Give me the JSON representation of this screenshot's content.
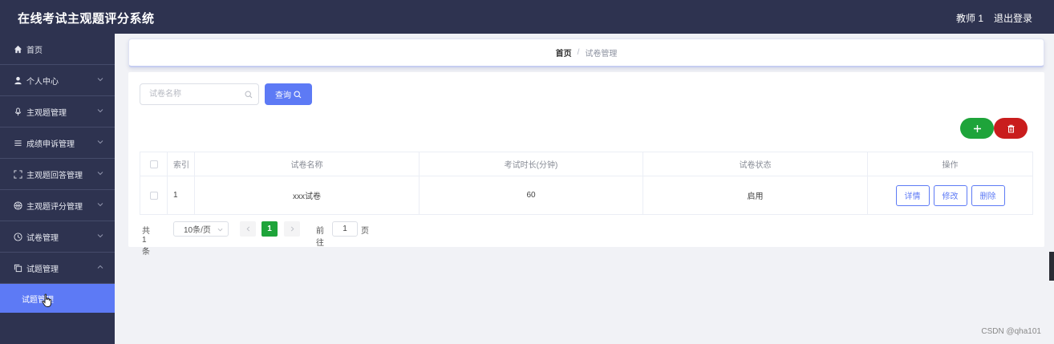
{
  "header": {
    "title": "在线考试主观题评分系统",
    "user": "教师 1",
    "logout": "退出登录"
  },
  "sidebar": {
    "items": [
      {
        "label": "首页",
        "icon": "home-icon"
      },
      {
        "label": "个人中心",
        "icon": "user-icon"
      },
      {
        "label": "主观题管理",
        "icon": "microphone-icon"
      },
      {
        "label": "成绩申诉管理",
        "icon": "list-icon"
      },
      {
        "label": "主观题回答管理",
        "icon": "fullscreen-icon"
      },
      {
        "label": "主观题评分管理",
        "icon": "basketball-icon"
      },
      {
        "label": "试卷管理",
        "icon": "clock-icon"
      },
      {
        "label": "试题管理",
        "icon": "copy-icon"
      }
    ],
    "subitem": "试题管理"
  },
  "breadcrumb": {
    "home": "首页",
    "separator": "/",
    "current": "试卷管理"
  },
  "search": {
    "placeholder": "试卷名称",
    "value": "",
    "button": "查询"
  },
  "table": {
    "columns": [
      "索引",
      "试卷名称",
      "考试时长(分钟)",
      "试卷状态",
      "操作"
    ],
    "rows": [
      {
        "index": "1",
        "name": "xxx试卷",
        "duration": "60",
        "status": "启用"
      }
    ],
    "actions": [
      "详情",
      "修改",
      "删除"
    ]
  },
  "pagination": {
    "total": "共 1 条",
    "page_size": "10条/页",
    "current": "1",
    "goto_label": "前往",
    "goto_value": "1",
    "page_suffix": "页"
  },
  "watermark": "CSDN @qha101",
  "colors": {
    "sidebar_bg": "#2e3350",
    "accent": "#5d7af5",
    "add_green": "#1ea43a",
    "delete_red": "#c91d1d"
  }
}
